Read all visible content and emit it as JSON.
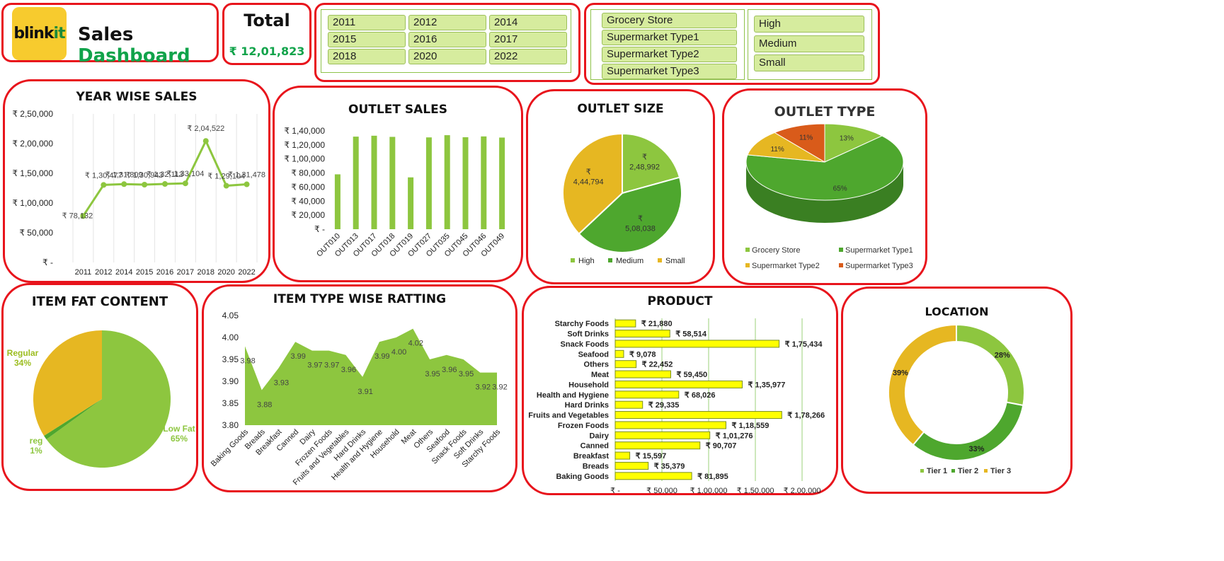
{
  "header": {
    "brand_logo": "blinkit",
    "brand_logo_main": "blink",
    "brand_logo_accent": "it",
    "title_part1": "Sales",
    "title_part2": "Dashboard",
    "total_label": "Total",
    "total_value": "₹ 12,01,823"
  },
  "slicers": {
    "years": [
      "2011",
      "2012",
      "2014",
      "2015",
      "2016",
      "2017",
      "2018",
      "2020",
      "2022"
    ],
    "outlet_types": [
      "Grocery Store",
      "Supermarket Type1",
      "Supermarket Type2",
      "Supermarket Type3"
    ],
    "outlet_sizes": [
      "High",
      "Medium",
      "Small"
    ]
  },
  "colors": {
    "border": "#e8141c",
    "light_green": "#8dc63f",
    "dark_green": "#4ea72e",
    "gold": "#e6b722",
    "orange": "#d95b1a",
    "yellow_bar": "#ffff00",
    "accent_text": "#10a34a"
  },
  "chart_data": [
    {
      "id": "year_wise_sales",
      "type": "line",
      "title": "YEAR WISE SALES",
      "categories": [
        "2011",
        "2012",
        "2014",
        "2015",
        "2016",
        "2017",
        "2018",
        "2020",
        "2022"
      ],
      "values": [
        78132,
        130477,
        131809,
        130943,
        132113,
        133104,
        204522,
        129104,
        131478
      ],
      "data_labels": [
        "₹ 78,132",
        "₹ 1,30,477",
        "₹ 1,31,809",
        "₹ 1,30,943",
        "₹ 1,32,113",
        "₹ 1,33,104",
        "₹ 2,04,522",
        "₹ 1,29,104",
        "₹ 1,31,478"
      ],
      "yticks": [
        "₹ -",
        "₹ 50,000",
        "₹ 1,00,000",
        "₹ 1,50,000",
        "₹ 2,00,000",
        "₹ 2,50,000"
      ],
      "ylim": [
        0,
        250000
      ]
    },
    {
      "id": "outlet_sales",
      "type": "bar",
      "title": "OUTLET SALES",
      "categories": [
        "OUT010",
        "OUT013",
        "OUT017",
        "OUT018",
        "OUT019",
        "OUT027",
        "OUT035",
        "OUT045",
        "OUT046",
        "OUT049"
      ],
      "values": [
        78132,
        131809,
        133104,
        131478,
        73808,
        130715,
        133872,
        130943,
        132113,
        130477
      ],
      "yticks": [
        "₹ -",
        "₹ 20,000",
        "₹ 40,000",
        "₹ 60,000",
        "₹ 80,000",
        "₹ 1,00,000",
        "₹ 1,20,000",
        "₹ 1,40,000"
      ],
      "ylim": [
        0,
        140000
      ]
    },
    {
      "id": "outlet_size",
      "type": "pie",
      "title": "OUTLET SIZE",
      "labels": [
        "High",
        "Medium",
        "Small"
      ],
      "values": [
        248992,
        508038,
        444794
      ],
      "data_labels": [
        [
          "₹",
          "2,48,992"
        ],
        [
          "₹",
          "5,08,038"
        ],
        [
          "₹",
          "4,44,794"
        ]
      ],
      "legend": "bottom"
    },
    {
      "id": "outlet_type",
      "type": "pie",
      "title": "OUTLET TYPE",
      "labels": [
        "Grocery Store",
        "Supermarket Type1",
        "Supermarket Type2",
        "Supermarket Type3"
      ],
      "values": [
        13,
        65,
        11,
        11
      ],
      "data_labels": [
        "13%",
        "65%",
        "11%",
        "11%"
      ],
      "legend": "bottom"
    },
    {
      "id": "item_fat_content",
      "type": "pie",
      "title": "ITEM FAT CONTENT",
      "labels": [
        "Low Fat",
        "reg",
        "Regular"
      ],
      "values": [
        65,
        1,
        34
      ],
      "data_labels": [
        "65%",
        "1%",
        "34%"
      ]
    },
    {
      "id": "item_type_rating",
      "type": "area",
      "title": "ITEM TYPE WISE RATTING",
      "categories": [
        "Baking Goods",
        "Breads",
        "Breakfast",
        "Canned",
        "Dairy",
        "Frozen Foods",
        "Fruits and Vegetables",
        "Hard Drinks",
        "Health and Hygiene",
        "Household",
        "Meat",
        "Others",
        "Seafood",
        "Snack Foods",
        "Soft Drinks",
        "Starchy Foods"
      ],
      "values": [
        3.98,
        3.88,
        3.93,
        3.99,
        3.97,
        3.97,
        3.96,
        3.91,
        3.99,
        4.0,
        4.02,
        3.95,
        3.96,
        3.95,
        3.92,
        3.92
      ],
      "data_labels": [
        "3.98",
        "3.88",
        "3.93",
        "3.99",
        "3.97",
        "3.97",
        "3.96",
        "3.91",
        "3.99",
        "4.00",
        "4.02",
        "3.95",
        "3.96",
        "3.95",
        "3.92",
        "3.92"
      ],
      "yticks": [
        "3.80",
        "3.85",
        "3.90",
        "3.95",
        "4.00",
        "4.05"
      ],
      "ylim": [
        3.8,
        4.05
      ]
    },
    {
      "id": "product",
      "type": "bar",
      "orientation": "horizontal",
      "title": "PRODUCT",
      "categories": [
        "Starchy Foods",
        "Soft Drinks",
        "Snack Foods",
        "Seafood",
        "Others",
        "Meat",
        "Household",
        "Health and Hygiene",
        "Hard Drinks",
        "Fruits and Vegetables",
        "Frozen Foods",
        "Dairy",
        "Canned",
        "Breakfast",
        "Breads",
        "Baking Goods"
      ],
      "values": [
        21880,
        58514,
        175434,
        9078,
        22452,
        59450,
        135977,
        68026,
        29335,
        178266,
        118559,
        101276,
        90707,
        15597,
        35379,
        81895
      ],
      "data_labels": [
        "₹ 21,880",
        "₹ 58,514",
        "₹ 1,75,434",
        "₹ 9,078",
        "₹ 22,452",
        "₹ 59,450",
        "₹ 1,35,977",
        "₹ 68,026",
        "₹ 29,335",
        "₹ 1,78,266",
        "₹ 1,18,559",
        "₹ 1,01,276",
        "₹ 90,707",
        "₹ 15,597",
        "₹ 35,379",
        "₹ 81,895"
      ],
      "xticks": [
        "₹ -",
        "₹ 50,000",
        "₹ 1,00,000",
        "₹ 1,50,000",
        "₹ 2,00,000"
      ],
      "xlim": [
        0,
        200000
      ]
    },
    {
      "id": "location",
      "type": "pie",
      "subtype": "donut",
      "title": "LOCATION",
      "labels": [
        "Tier 1",
        "Tier 2",
        "Tier 3"
      ],
      "values": [
        28,
        33,
        39
      ],
      "data_labels": [
        "28%",
        "33%",
        "39%"
      ],
      "legend": "bottom"
    }
  ]
}
